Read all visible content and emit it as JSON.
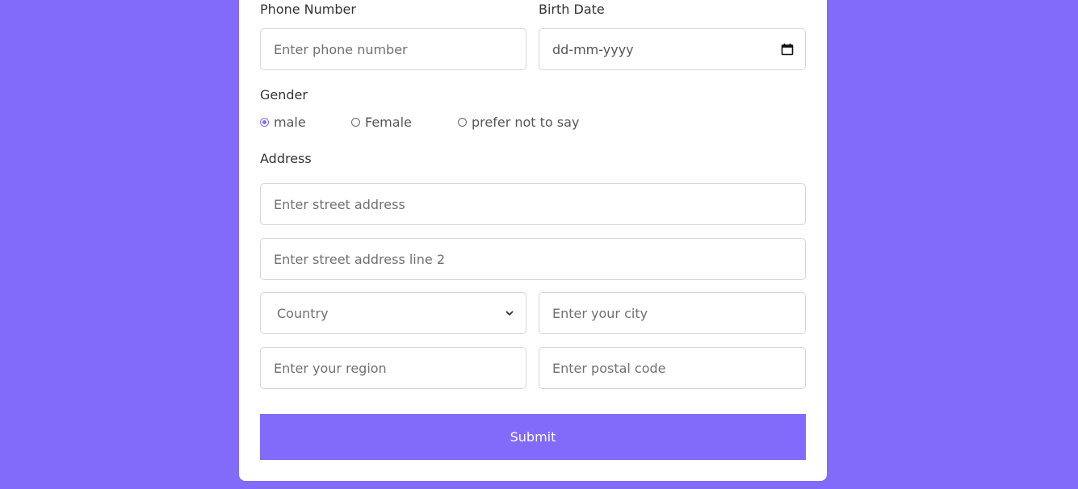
{
  "form": {
    "phone": {
      "label": "Phone Number",
      "placeholder": "Enter phone number"
    },
    "birth_date": {
      "label": "Birth Date",
      "placeholder": "dd-mm-yyyy",
      "icon": "calendar-icon"
    },
    "gender": {
      "label": "Gender",
      "options": [
        {
          "label": "male",
          "checked": true
        },
        {
          "label": "Female",
          "checked": false
        },
        {
          "label": "prefer not to say",
          "checked": false
        }
      ]
    },
    "address": {
      "label": "Address",
      "street_placeholder": "Enter street address",
      "street2_placeholder": "Enter street address line 2",
      "country_selected": "Country",
      "city_placeholder": "Enter your city",
      "region_placeholder": "Enter your region",
      "postal_placeholder": "Enter postal code"
    },
    "submit_label": "Submit"
  },
  "colors": {
    "accent": "#826bfa",
    "background": "#826bfa",
    "card": "#ffffff",
    "border": "#d6d6d6"
  }
}
